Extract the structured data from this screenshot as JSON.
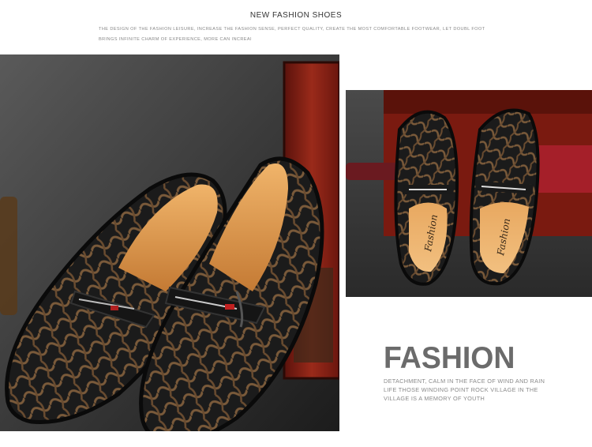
{
  "header": {
    "title": "NEW FASHION SHOES",
    "description": "THE DESIGN OF THE FASHION LEISURE, INCREASE THE FASHION SENSE, PERFECT QUALITY, CREATE THE MOST COMFORTABLE FOOTWEAR, LET DOUBL FOOT BRINGS INFINITE CHARM OF EXPERIENCE, MORE CAN INCREAI"
  },
  "product": {
    "insole_brand": "Fashion"
  },
  "feature": {
    "heading": "FASHION",
    "description": "DETACHMENT, CALM IN THE FACE OF WIND AND RAIN LIFE THOSE WINDING POINT ROCK VILLAGE IN THE VILLAGE IS A MEMORY OF YOUTH"
  },
  "colors": {
    "leather_dark": "#1e1e1e",
    "pattern_brown": "#7a5a3a",
    "insole_tan": "#d99a55",
    "chest_red": "#8a1f14",
    "heading_gray": "#6b6b6b"
  }
}
